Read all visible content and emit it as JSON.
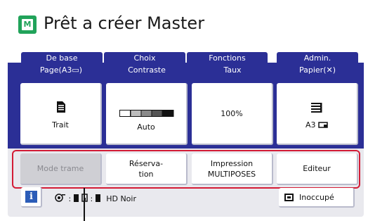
{
  "header": {
    "title": "Prêt a créer Master",
    "icon": "master-icon",
    "icon_letter": "M"
  },
  "tabs": [
    {
      "label": "De base",
      "active": true
    },
    {
      "label": "Choix",
      "active": false
    },
    {
      "label": "Fonctions",
      "active": false
    },
    {
      "label": "Admin.",
      "active": false
    }
  ],
  "settings": {
    "page": {
      "label": "Page(A3▭)",
      "value": "Trait",
      "icon": "document-text-icon"
    },
    "contrast": {
      "label": "Contraste",
      "value": "Auto",
      "icon": "contrast-scale-icon"
    },
    "rate": {
      "label": "Taux",
      "value": "100%"
    },
    "paper": {
      "label": "Papier(✕)",
      "value": "A3",
      "icon": "paper-tray-icon"
    }
  },
  "function_buttons": [
    {
      "label": "Mode trame",
      "disabled": true
    },
    {
      "label": "Réserva-\ntion",
      "disabled": false
    },
    {
      "label": "Impression\nMULTIPOSES",
      "disabled": false
    },
    {
      "label": "Editeur",
      "disabled": false
    }
  ],
  "status": {
    "info_button": "i",
    "drum_icon": "drum-icon",
    "ink_icon": "ink-icon",
    "ink_text": "HD Noir",
    "state_button": "Inoccupé",
    "state_icon": "monitor-icon"
  },
  "colors": {
    "accent": "#2b2f96",
    "highlight": "#d31c36",
    "brand": "#21a35a",
    "info": "#2b5cb8"
  }
}
